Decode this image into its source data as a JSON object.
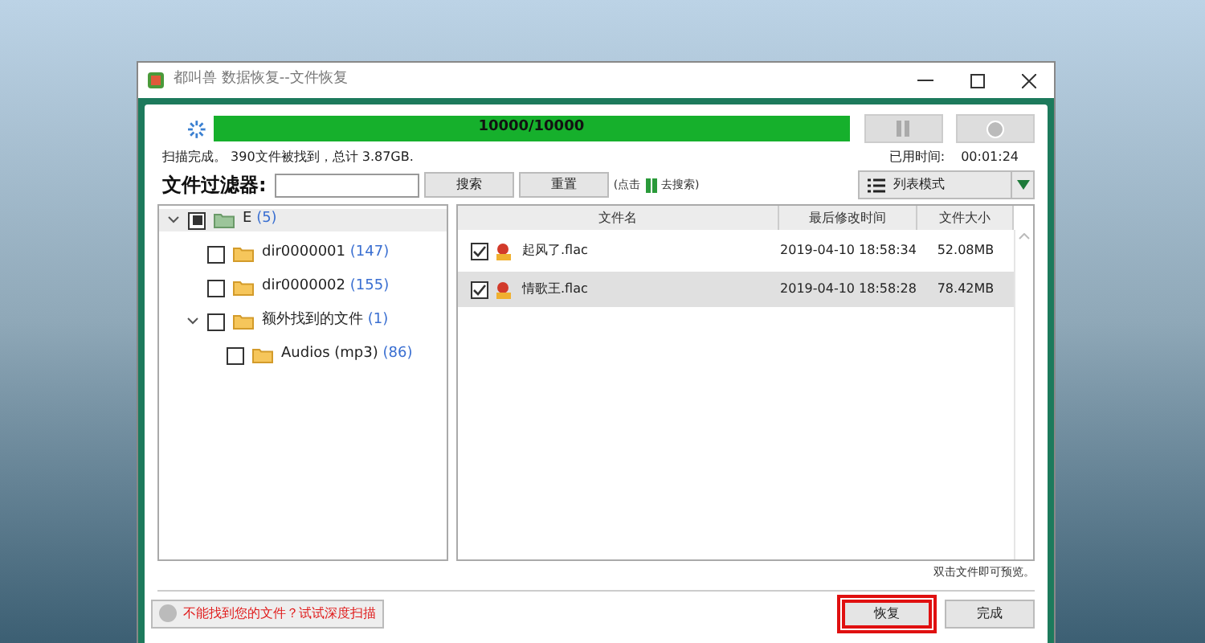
{
  "window": {
    "title": "都叫兽 数据恢复--文件恢复"
  },
  "scan": {
    "progress_text": "10000/10000",
    "level": 1,
    "status": "扫描完成。 390文件被找到，总计 3.87GB.",
    "elapsed_label": "已用时间:",
    "elapsed": "00:01:24"
  },
  "filter": {
    "label": "文件过滤器:",
    "search_button": "搜索",
    "reset_button": "重置",
    "hint_before": "(点击",
    "hint_after": "去搜索)"
  },
  "view_mode": {
    "label": "列表模式"
  },
  "tree": [
    {
      "name": "E",
      "count": "(5)",
      "partial": true,
      "expanded": true,
      "children": [
        {
          "name": "dir0000001",
          "count": "(147)",
          "partial": false
        },
        {
          "name": "dir0000002",
          "count": "(155)",
          "partial": false
        },
        {
          "name": "额外找到的文件",
          "count": "(1)",
          "partial": false,
          "expanded": true,
          "children": [
            {
              "name": "Audios (mp3)",
              "count": "(86)",
              "partial": false
            }
          ]
        }
      ]
    }
  ],
  "table": {
    "columns": [
      "文件名",
      "最后修改时间",
      "文件大小"
    ],
    "rows": [
      {
        "name": "起风了.flac",
        "modified": "2019-04-10 18:58:34",
        "size": "52.08MB",
        "checked": true,
        "selected": false
      },
      {
        "name": "情歌王.flac",
        "modified": "2019-04-10 18:58:28",
        "size": "78.42MB",
        "checked": true,
        "selected": true
      }
    ]
  },
  "preview_hint": "双击文件即可预览。",
  "deep_scan_button": "不能找到您的文件？试试深度扫描",
  "buttons": [
    {
      "label": "恢复",
      "highlighted": true
    },
    {
      "label": "完成",
      "highlighted": false
    }
  ]
}
